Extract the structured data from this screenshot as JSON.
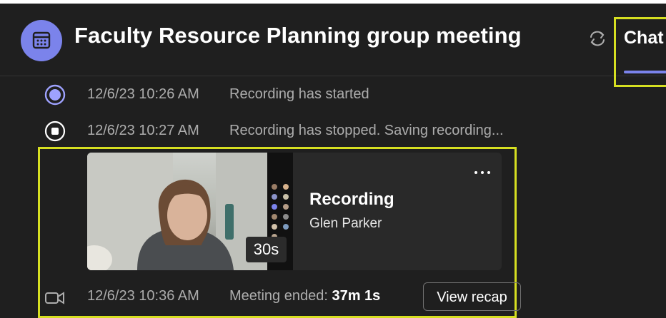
{
  "header": {
    "title": "Faculty Resource Planning group meeting",
    "tab_label": "Chat",
    "calendar_icon": "calendar-icon",
    "sync_icon": "sync-icon"
  },
  "events": [
    {
      "time": "12/6/23 10:26 AM",
      "text": "Recording has started",
      "icon": "record-start-icon"
    },
    {
      "time": "12/6/23 10:27 AM",
      "text": "Recording has stopped. Saving recording...",
      "icon": "record-stop-icon"
    }
  ],
  "recording_card": {
    "title": "Recording",
    "subtitle": "Glen Parker",
    "duration": "30s",
    "more_icon": "more-options-icon"
  },
  "meeting_end": {
    "time": "12/6/23 10:36 AM",
    "text": "Meeting ended:",
    "duration": "37m 1s",
    "button_label": "View recap",
    "icon": "video-camera-icon"
  },
  "colors": {
    "accent": "#7b83eb",
    "highlight": "#d6df21",
    "background": "#1f1f1f",
    "card": "#292929"
  }
}
